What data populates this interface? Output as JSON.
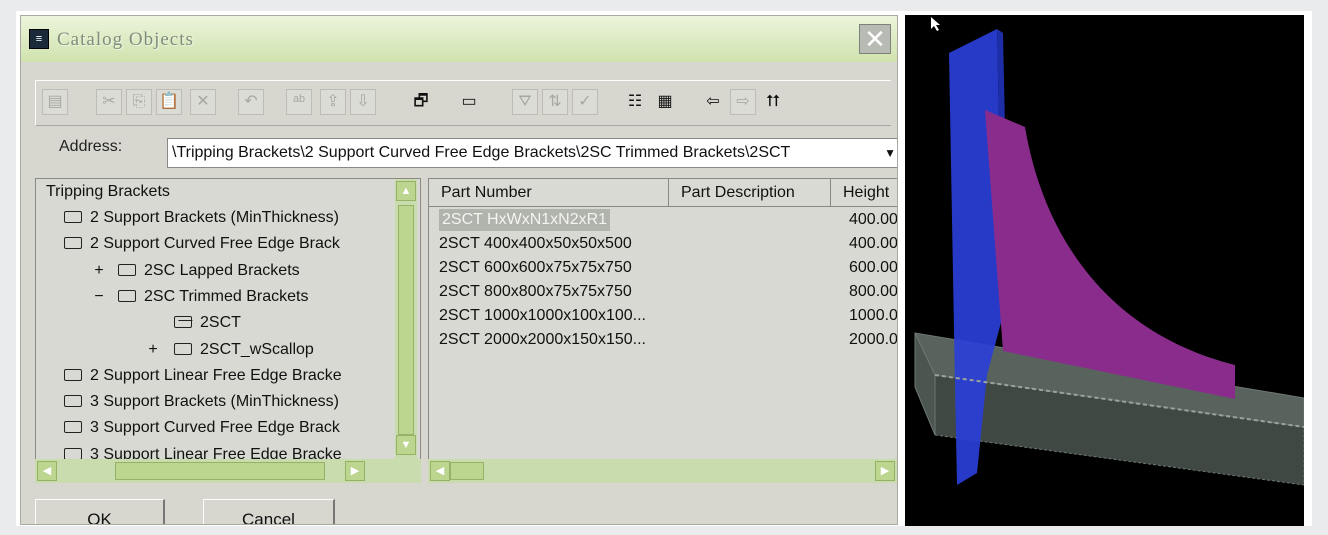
{
  "dialog": {
    "title": "Catalog Objects",
    "close_label": "✕",
    "address_label": "Address:",
    "address_value": "\\Tripping Brackets\\2 Support Curved Free Edge Brackets\\2SC Trimmed Brackets\\2SCT",
    "ok_label": "OK",
    "cancel_label": "Cancel"
  },
  "toolbar": {
    "buttons": [
      {
        "icon": "save-icon",
        "glyph": "▤",
        "enabled": false
      },
      {
        "icon": "cut-icon",
        "glyph": "✂",
        "enabled": false
      },
      {
        "icon": "copy-icon",
        "glyph": "⎘",
        "enabled": false
      },
      {
        "icon": "paste-icon",
        "glyph": "📋",
        "enabled": false
      },
      {
        "icon": "delete-icon",
        "glyph": "✕",
        "enabled": false
      },
      {
        "icon": "undo-icon",
        "glyph": "↶",
        "enabled": false
      },
      {
        "icon": "rename-icon",
        "glyph": "ᵃᵇ",
        "enabled": false
      },
      {
        "icon": "import-icon",
        "glyph": "⇪",
        "enabled": false
      },
      {
        "icon": "export-icon",
        "glyph": "⇩",
        "enabled": false
      },
      {
        "icon": "properties-icon",
        "glyph": "🗗",
        "enabled": true
      },
      {
        "icon": "window-icon",
        "glyph": "▭",
        "enabled": true
      },
      {
        "icon": "filter-icon",
        "glyph": "⛛",
        "enabled": false
      },
      {
        "icon": "sort-icon",
        "glyph": "⇅",
        "enabled": false
      },
      {
        "icon": "check-icon",
        "glyph": "✓",
        "enabled": false
      },
      {
        "icon": "list-view-icon",
        "glyph": "☷",
        "enabled": true
      },
      {
        "icon": "details-view-icon",
        "glyph": "▦",
        "enabled": true
      },
      {
        "icon": "back-icon",
        "glyph": "⇦",
        "enabled": true
      },
      {
        "icon": "forward-icon",
        "glyph": "⇨",
        "enabled": false
      },
      {
        "icon": "up-folder-icon",
        "glyph": "⮅",
        "enabled": true
      }
    ]
  },
  "tree": {
    "root": "Tripping Brackets",
    "items": [
      {
        "label": "2 Support Brackets (MinThickness)",
        "level": 1,
        "expander": "",
        "open": false
      },
      {
        "label": "2 Support Curved Free Edge Brack",
        "level": 1,
        "expander": "",
        "open": false
      },
      {
        "label": "2SC Lapped Brackets",
        "level": 2,
        "expander": "+",
        "open": false
      },
      {
        "label": "2SC Trimmed Brackets",
        "level": 2,
        "expander": "−",
        "open": false
      },
      {
        "label": "2SCT",
        "level": 3,
        "expander": "",
        "open": true
      },
      {
        "label": "2SCT_wScallop",
        "level": 3,
        "expander": "+",
        "open": false
      },
      {
        "label": "2 Support Linear Free Edge Bracke",
        "level": 1,
        "expander": "",
        "open": false
      },
      {
        "label": "3 Support Brackets (MinThickness)",
        "level": 1,
        "expander": "",
        "open": false
      },
      {
        "label": "3 Support Curved Free Edge Brack",
        "level": 1,
        "expander": "",
        "open": false
      },
      {
        "label": "3 Support Linear Free Edge Bracke",
        "level": 1,
        "expander": "",
        "open": false
      }
    ]
  },
  "table": {
    "headers": [
      "Part Number",
      "Part Description",
      "Height"
    ],
    "rows": [
      {
        "part": "2SCT HxWxN1xN2xR1",
        "height": "400.00",
        "selected": true
      },
      {
        "part": "2SCT 400x400x50x50x500",
        "height": "400.00",
        "selected": false
      },
      {
        "part": "2SCT 600x600x75x75x750",
        "height": "600.00",
        "selected": false
      },
      {
        "part": "2SCT 800x800x75x75x750",
        "height": "800.00",
        "selected": false
      },
      {
        "part": "2SCT 1000x1000x100x100...",
        "height": "1000.0",
        "selected": false
      },
      {
        "part": "2SCT 2000x2000x150x150...",
        "height": "2000.0",
        "selected": false
      }
    ]
  },
  "viewport": {
    "colors": {
      "plate": "#2a3fd8",
      "bracket": "#8a2c8c",
      "beam": "#4b5550",
      "background": "#000000"
    }
  }
}
